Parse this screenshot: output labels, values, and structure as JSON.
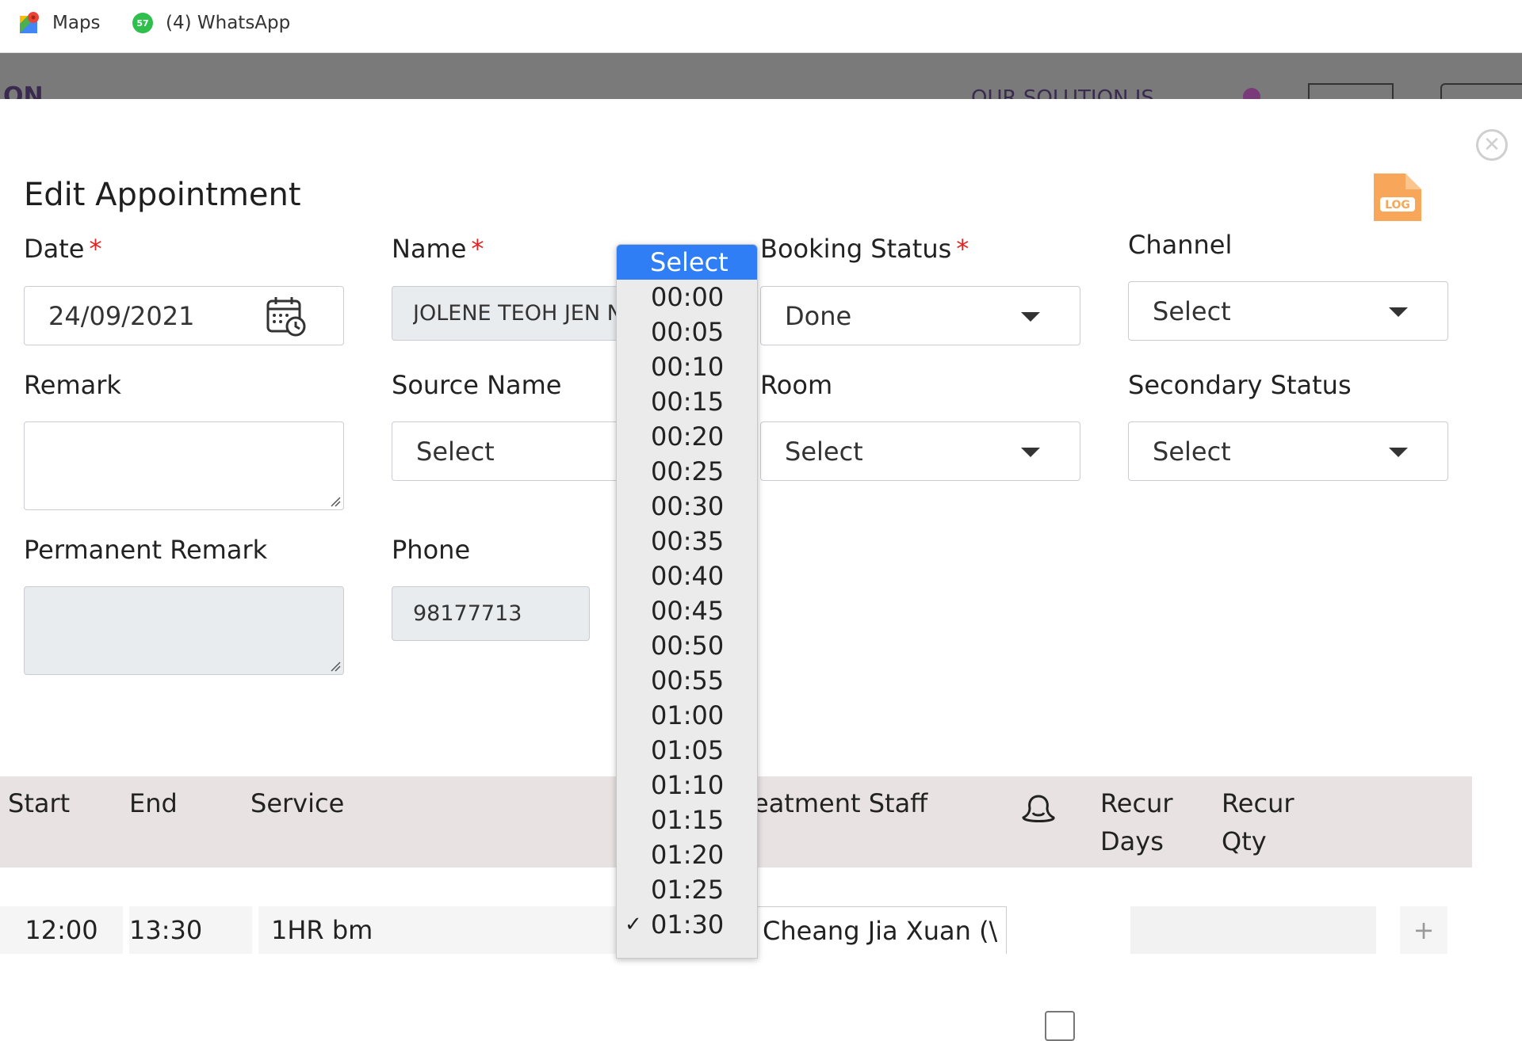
{
  "bookmarks": [
    {
      "label": "Maps",
      "icon": "maps-icon"
    },
    {
      "label": "(4) WhatsApp",
      "icon": "whatsapp-icon",
      "badge": "57"
    }
  ],
  "modal": {
    "title": "Edit Appointment",
    "log_icon_label": "LOG",
    "fields": {
      "date": {
        "label": "Date",
        "value": "24/09/2021"
      },
      "name": {
        "label": "Name",
        "value": "JOLENE TEOH JEN N"
      },
      "booking_status": {
        "label": "Booking Status",
        "value": "Done"
      },
      "channel": {
        "label": "Channel",
        "value": "Select"
      },
      "remark": {
        "label": "Remark",
        "value": ""
      },
      "source_name": {
        "label": "Source Name",
        "value": "Select"
      },
      "room": {
        "label": "Room",
        "value": "Select"
      },
      "secondary_status": {
        "label": "Secondary Status",
        "value": "Select"
      },
      "permanent_remark": {
        "label": "Permanent Remark",
        "value": ""
      },
      "phone": {
        "label": "Phone",
        "value": "98177713"
      }
    },
    "required_marker": "*"
  },
  "table": {
    "headers": {
      "start": "Start",
      "end": "End",
      "service": "Service",
      "treatment_staff": "eatment Staff",
      "recur_days_1": "Recur",
      "recur_days_2": "Days",
      "recur_qty_1": "Recur",
      "recur_qty_2": "Qty"
    },
    "row": {
      "start": "12:00",
      "end": "13:30",
      "service": "1HR bm",
      "staff": "Cheang Jia Xuan (\\",
      "add": "+"
    }
  },
  "duration_dropdown": {
    "selected_index": 0,
    "checked": "01:30",
    "options": [
      "Select",
      "00:00",
      "00:05",
      "00:10",
      "00:15",
      "00:20",
      "00:25",
      "00:30",
      "00:35",
      "00:40",
      "00:45",
      "00:50",
      "00:55",
      "01:00",
      "01:05",
      "01:10",
      "01:15",
      "01:20",
      "01:25",
      "01:30"
    ]
  },
  "colors": {
    "accent": "#2f7ef6",
    "required": "#e02424",
    "header_bg": "#e8e2e2",
    "log_icon": "#f7a65a"
  }
}
